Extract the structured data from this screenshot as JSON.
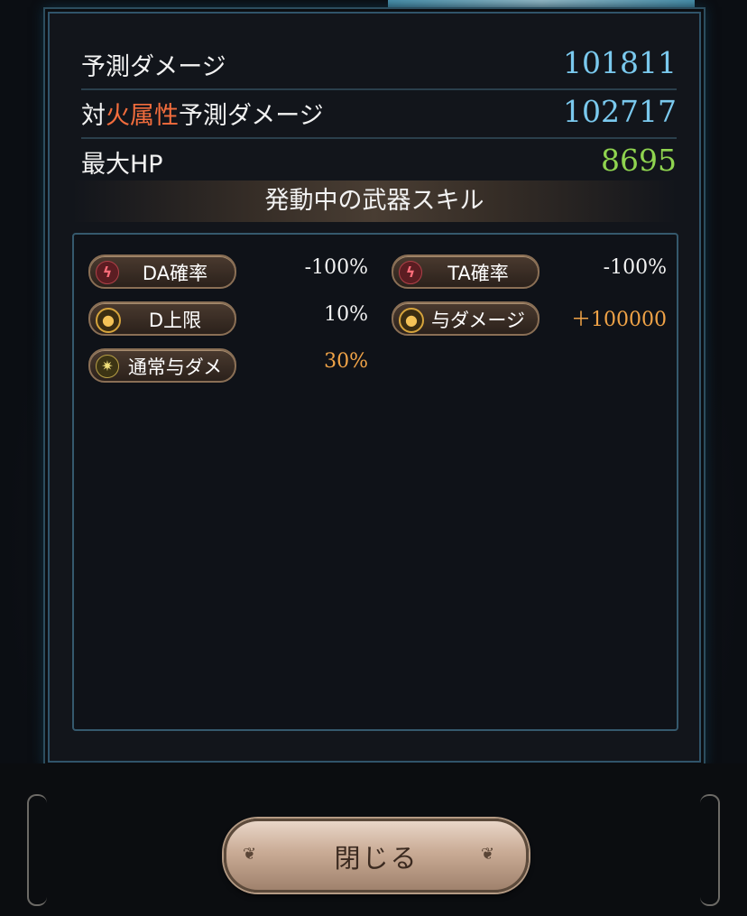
{
  "stats": {
    "predicted_damage": {
      "label": "予測ダメージ",
      "value": "101811"
    },
    "vs_fire_damage": {
      "prefix": "対",
      "element": "火属性",
      "suffix": "予測ダメージ",
      "value": "102717"
    },
    "max_hp": {
      "label": "最大HP",
      "value": "8695"
    }
  },
  "skills_title": "発動中の武器スキル",
  "skills": [
    {
      "name": "DA確率",
      "value": "-100%",
      "icon": "double-attack-icon"
    },
    {
      "name": "TA確率",
      "value": "-100%",
      "icon": "triple-attack-icon"
    },
    {
      "name": "D上限",
      "value": "10%",
      "icon": "sun-icon"
    },
    {
      "name": "与ダメージ",
      "value": "＋100000",
      "icon": "sun-icon"
    },
    {
      "name": "通常与ダメ",
      "value": "30%",
      "icon": "sparkle-icon"
    }
  ],
  "close_button": "閉じる",
  "colors": {
    "stat_blue": "#7ac9ee",
    "stat_green": "#8fd44f",
    "fire": "#f36d3d",
    "skill_value_orange": "#f0a347"
  }
}
